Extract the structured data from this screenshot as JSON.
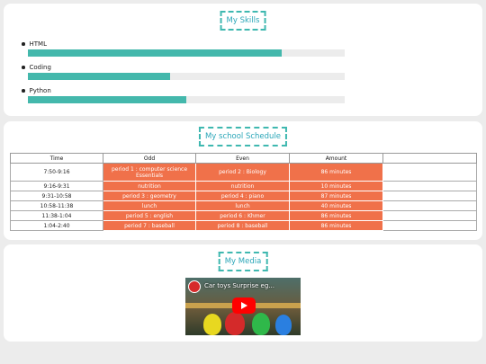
{
  "skills": {
    "title": "My Skills",
    "items": [
      {
        "label": "HTML",
        "level": 0.8
      },
      {
        "label": "Coding",
        "level": 0.45
      },
      {
        "label": "Python",
        "level": 0.5
      }
    ]
  },
  "schedule": {
    "title": "My school Schedule",
    "headers": [
      "Time",
      "Odd",
      "Even",
      "Amount"
    ],
    "rows": [
      [
        "7:50-9:16",
        "period 1 : computer science Essentials",
        "period 2 : Biology",
        "86 minutes"
      ],
      [
        "9:16-9:31",
        "nutrition",
        "nutrition",
        "10 minutes"
      ],
      [
        "9:31-10:58",
        "period 3 : geometry",
        "period 4 : piano",
        "87 minutes"
      ],
      [
        "10:58-11:38",
        "lunch",
        "lunch",
        "40 minutes"
      ],
      [
        "11:38-1:04",
        "period 5 : english",
        "period 6 : Khmer",
        "86 minutes"
      ],
      [
        "1:04-2:40",
        "period 7 : baseball",
        "period 8 : baseball",
        "86 minutes"
      ]
    ]
  },
  "media": {
    "title": "My Media",
    "video_title": "Car toys Surprise eg..."
  },
  "colors": {
    "accent": "#3fb8b0",
    "bar": "#44b8ac",
    "highlight": "#f0714a"
  }
}
